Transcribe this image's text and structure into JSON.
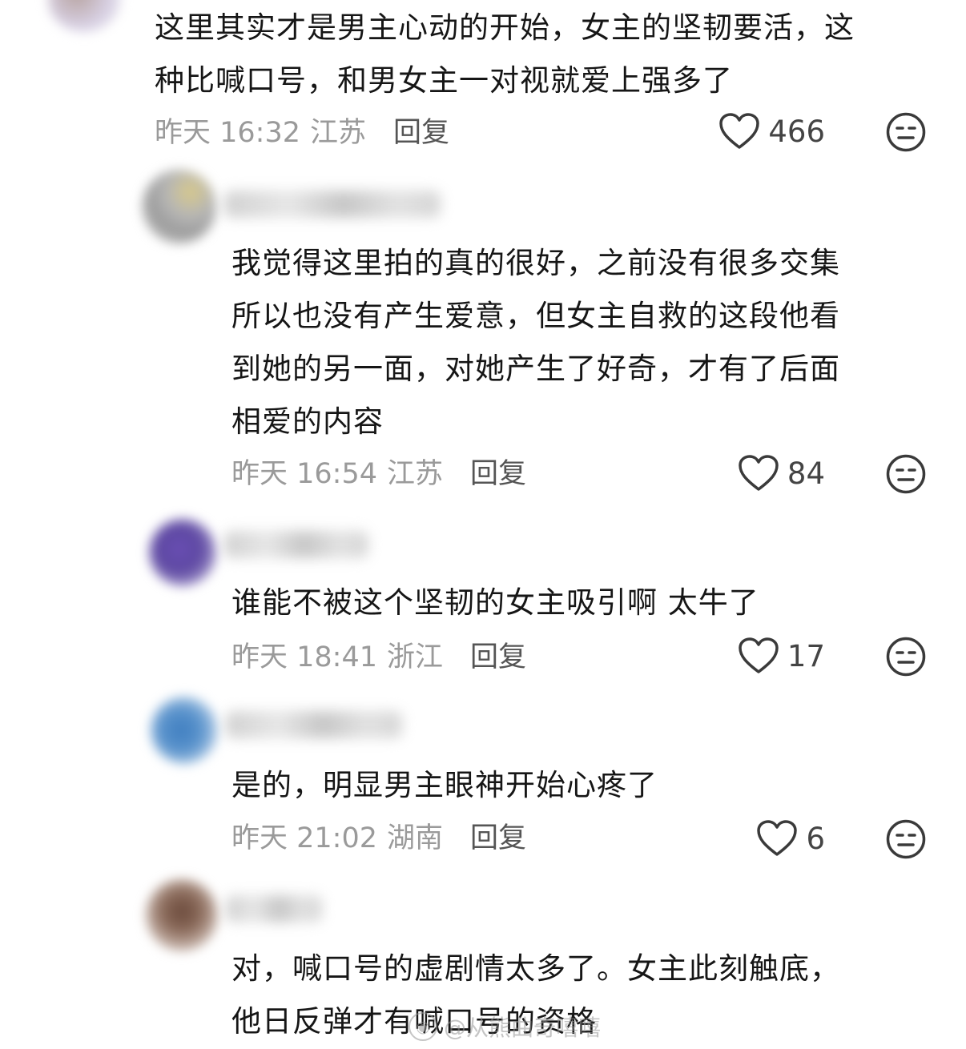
{
  "comments": [
    {
      "text": "这里其实才是男主心动的开始，女主的坚韧要活，这\n种比喊口号，和男女主一对视就爱上强多了",
      "time": "昨天 16:32",
      "location": "江苏",
      "reply": "回复",
      "likes": "466"
    },
    {
      "text": "我觉得这里拍的真的很好，之前没有很多交集\n所以也没有产生爱意，但女主自救的这段他看\n到她的另一面，对她产生了好奇，才有了后面\n相爱的内容",
      "time": "昨天 16:54",
      "location": "江苏",
      "reply": "回复",
      "likes": "84"
    },
    {
      "text": "谁能不被这个坚韧的女主吸引啊  太牛了",
      "time": "昨天 18:41",
      "location": "浙江",
      "reply": "回复",
      "likes": "17"
    },
    {
      "text": "是的，明显男主眼神开始心疼了",
      "time": "昨天 21:02",
      "location": "湖南",
      "reply": "回复",
      "likes": "6"
    },
    {
      "text": "对，喊口号的虚剧情太多了。女主此刻触底，\n他日反弹才有喊口号的资格"
    }
  ],
  "watermark": "@从熊曲奇嘻嘻",
  "icons": {
    "like": "heart-outline-icon",
    "dislike": "unamused-face-icon"
  },
  "colors": {
    "text": "#161616",
    "meta": "#9a9a9a",
    "reply": "#555555",
    "icon": "#3a3a3a"
  }
}
